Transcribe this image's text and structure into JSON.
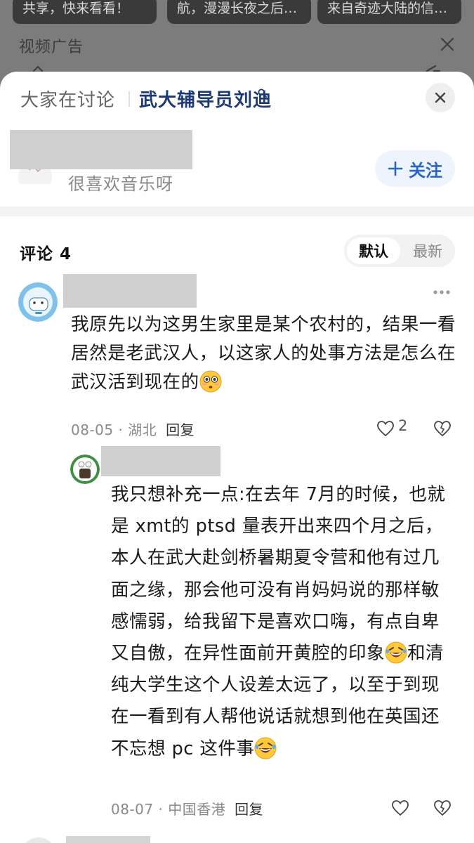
{
  "background": {
    "cards": [
      {
        "text": "共享，快来看看！"
      },
      {
        "text": "航，漫漫长夜之后…"
      },
      {
        "text": "来自奇迹大陆的信…"
      }
    ],
    "ad_label": "视频广告",
    "ad_close_icon": "close-icon"
  },
  "sheet": {
    "discuss_label": "大家在讨论",
    "topic": "武大辅导员刘迪",
    "topic_icon": "search-icon",
    "close_icon": "close-icon"
  },
  "author": {
    "bio": "很喜欢音乐呀",
    "follow_label": "关注",
    "follow_icon": "plus-icon"
  },
  "comments_header": {
    "title": "评论 4",
    "sort_default": "默认",
    "sort_latest": "最新"
  },
  "comments": [
    {
      "text": "我原先以为这男生家里是某个农村的，结果一看居然是老武汉人，以这家人的处事方法是怎么在武汉活到现在的",
      "emoji": "flushed-emoji",
      "date": "08-05",
      "location": "湖北",
      "reply_label": "回复",
      "likes": "2",
      "replies": [
        {
          "text_parts": [
            "我只想补充一点:在去年 7月的时候，也就是 xmt的 ptsd 量表开出来四个月之后，本人在武大赴剑桥暑期夏令营和他有过几面之缘，那会他可没有肖妈妈说的那样敏感懦弱，给我留下是喜欢口嗨，有点自卑又自傲，在异性面前开黄腔的印象",
            "和清纯大学生这个人设差太远了，以至于到现在一看到有人帮他说话就想到他在英国还不忘想 pc 这件事"
          ],
          "emoji": "rolling-laughing-emoji",
          "date": "08-07",
          "location": "中国香港",
          "reply_label": "回复"
        }
      ]
    }
  ],
  "colors": {
    "topic": "#1d3a77",
    "follow_text": "#2a64c6",
    "follow_bg": "#eef4fd",
    "overlay": "#7c7c7c"
  }
}
